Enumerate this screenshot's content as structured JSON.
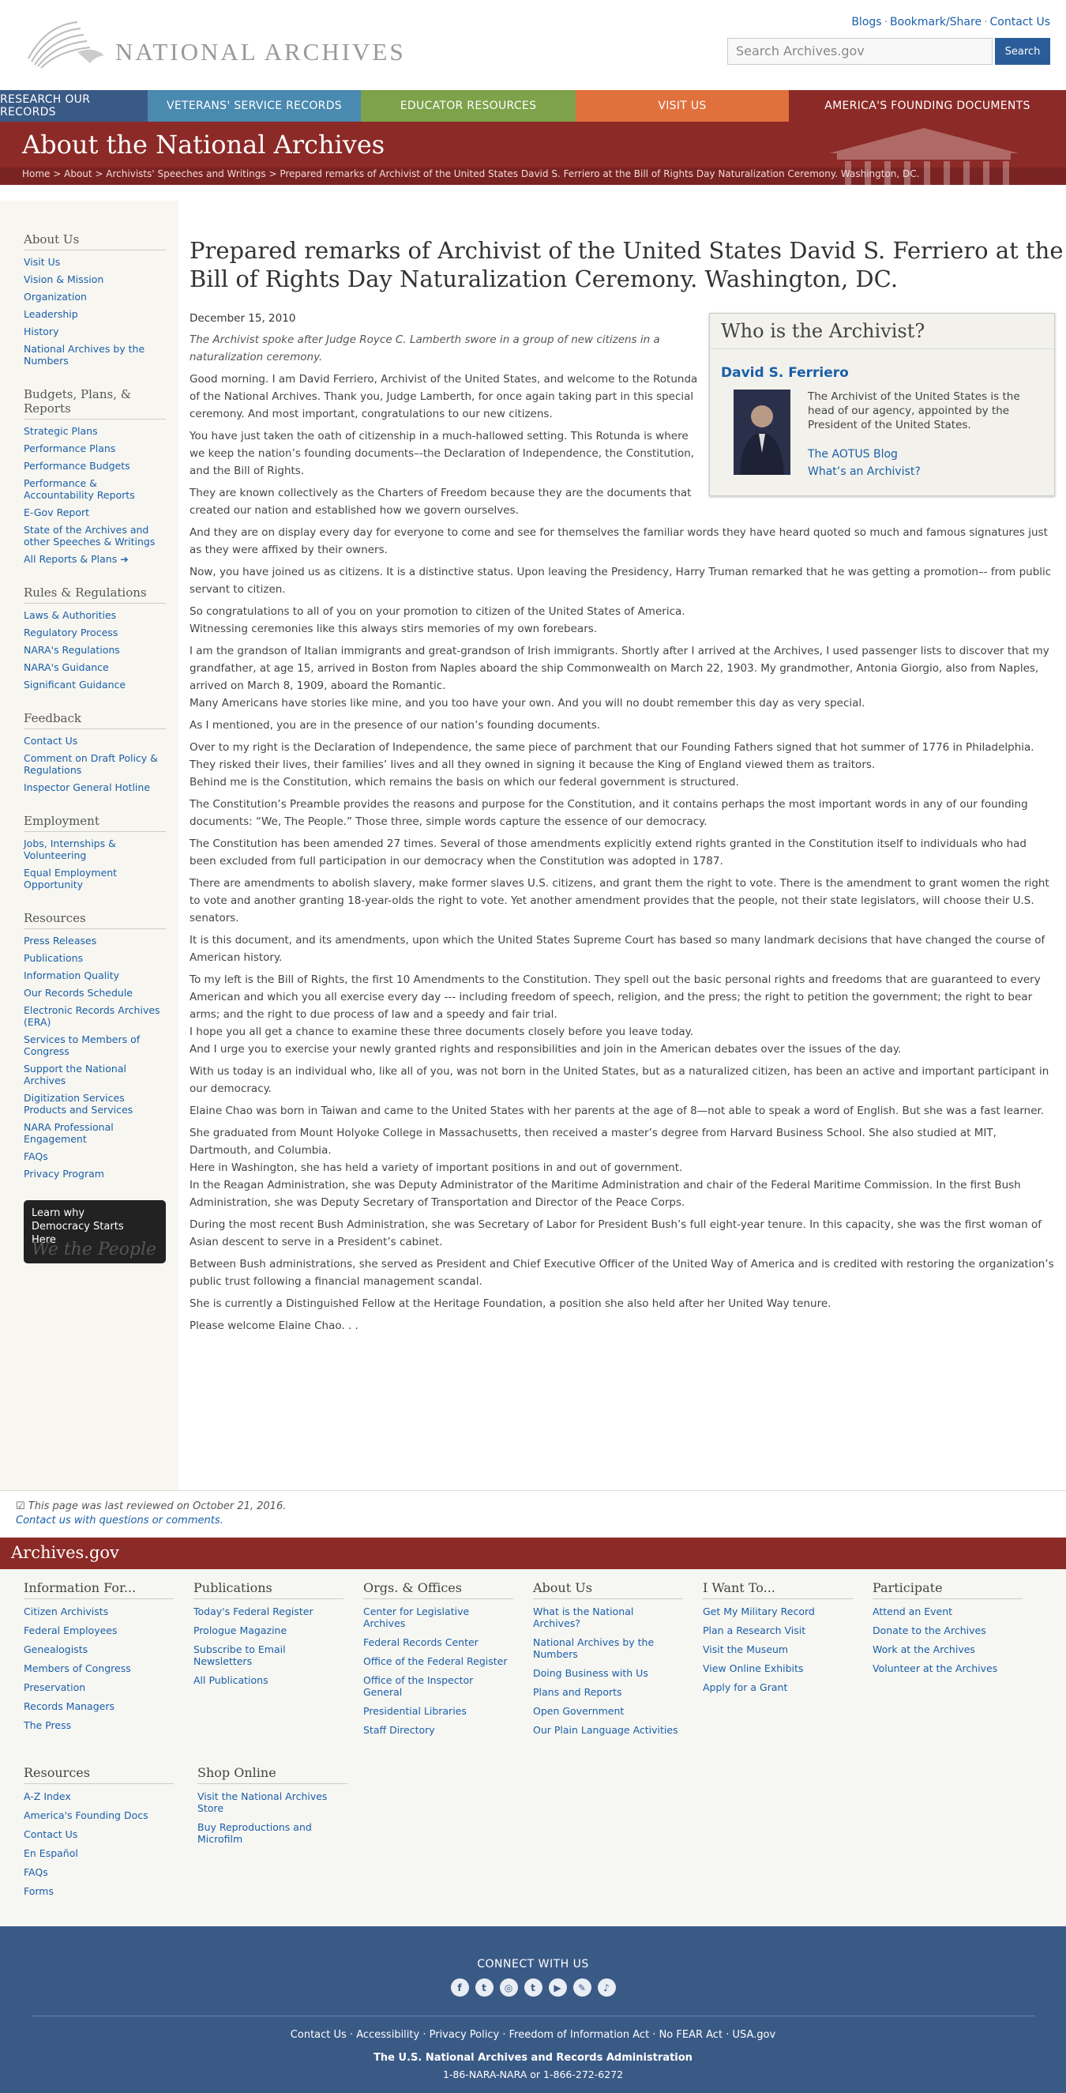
{
  "header": {
    "logo_text": "NATIONAL ARCHIVES",
    "links": [
      "Blogs",
      "Bookmark/Share",
      "Contact Us"
    ],
    "search_placeholder": "Search Archives.gov",
    "search_button": "Search"
  },
  "nav": [
    {
      "label": "RESEARCH OUR RECORDS",
      "color": "#3a5a86"
    },
    {
      "label": "VETERANS' SERVICE RECORDS",
      "color": "#4a8ab0"
    },
    {
      "label": "EDUCATOR RESOURCES",
      "color": "#7da24a"
    },
    {
      "label": "VISIT US",
      "color": "#e0703c"
    },
    {
      "label": "AMERICA'S FOUNDING DOCUMENTS",
      "color": "#8c2a27"
    }
  ],
  "banner": {
    "title": "About the National Archives",
    "crumbs": [
      "Home",
      "About",
      "Archivists' Speeches and Writings",
      "Prepared remarks of Archivist of the United States David S. Ferriero at the Bill of Rights Day Naturalization Ceremony. Washington, DC."
    ]
  },
  "sidebar": [
    {
      "heading": "About Us",
      "items": [
        "Visit Us",
        "Vision & Mission",
        "Organization",
        "Leadership",
        "History",
        "National Archives by the Numbers"
      ]
    },
    {
      "heading": "Budgets, Plans, & Reports",
      "items": [
        "Strategic Plans",
        "Performance Plans",
        "Performance Budgets",
        "Performance & Accountability Reports",
        "E-Gov Report",
        "State of the Archives and other Speeches & Writings",
        "All Reports & Plans"
      ]
    },
    {
      "heading": "Rules & Regulations",
      "items": [
        "Laws & Authorities",
        "Regulatory Process",
        "NARA's Regulations",
        "NARA's Guidance",
        "Significant Guidance"
      ]
    },
    {
      "heading": "Feedback",
      "items": [
        "Contact Us",
        "Comment on Draft Policy & Regulations",
        "Inspector General Hotline"
      ]
    },
    {
      "heading": "Employment",
      "items": [
        "Jobs, Internships & Volunteering",
        "Equal Employment Opportunity"
      ]
    },
    {
      "heading": "Resources",
      "items": [
        "Press Releases",
        "Publications",
        "Information Quality",
        "Our Records Schedule",
        "Electronic Records Archives (ERA)",
        "Services to Members of Congress",
        "Support the National Archives",
        "Digitization Services Products and Services",
        "NARA Professional Engagement",
        "FAQs",
        "Privacy Program"
      ]
    }
  ],
  "promo": {
    "text": "Learn why Democracy Starts Here",
    "script": "We the People"
  },
  "main": {
    "title": "Prepared remarks of Archivist of the United States David S. Ferriero at the Bill of Rights Day Naturalization Ceremony. Washington, DC.",
    "date": "December 15, 2010",
    "intro": "The Archivist spoke after Judge Royce C. Lamberth swore in a group of new citizens in a naturalization ceremony.",
    "paragraphs": [
      "Good morning. I am David Ferriero, Archivist of the United States, and welcome to the Rotunda of the National Archives. Thank you, Judge Lamberth, for once again taking part in this special ceremony. And most important, congratulations to our new citizens.",
      "You have just taken the oath of citizenship in a much-hallowed setting. This Rotunda is where we keep the nation’s founding documents–-the Declaration of Independence, the Constitution, and the Bill of Rights.",
      "They are known collectively as the Charters of Freedom because they are the documents that created our nation and established how we govern ourselves.",
      "And they are on display every day for everyone to come and see for themselves the familiar words they have heard quoted so much and famous signatures just as they were affixed by their owners.",
      "Now, you have joined us as citizens. It is a distinctive status. Upon leaving the Presidency, Harry Truman remarked that he was getting a promotion–- from public servant to citizen.",
      "So congratulations to all of you on your promotion to citizen of the United States of America.",
      "Witnessing ceremonies like this always stirs memories of my own forebears.",
      "I am the grandson of Italian immigrants and great-grandson of Irish immigrants. Shortly after I arrived at the Archives, I used passenger lists to discover that my grandfather, at age 15, arrived in Boston from Naples aboard the ship Commonwealth on March 22, 1903. My grandmother, Antonia Giorgio, also from Naples, arrived on March 8, 1909, aboard the Romantic.",
      "Many Americans have stories like mine, and you too have your own. And you will no doubt remember this day as very special.",
      "As I mentioned, you are in the presence of our nation’s founding documents.",
      "Over to my right is the Declaration of Independence, the same piece of parchment that our Founding Fathers signed that hot summer of 1776 in Philadelphia. They risked their lives, their families’ lives and all they owned in signing it because the King of England viewed them as traitors.",
      "Behind me is the Constitution, which remains the basis on which our federal government is structured.",
      "The Constitution’s Preamble provides the reasons and purpose for the Constitution, and it contains perhaps the most important words in any of our founding documents:  “We, The People.”   Those three, simple words capture the essence of our democracy.",
      "The Constitution has been amended 27 times. Several of those amendments explicitly extend rights granted in the Constitution itself to individuals who had been excluded from full participation in our democracy when the Constitution was adopted in 1787.",
      "There are amendments to abolish slavery, make former slaves U.S. citizens, and grant them the right to vote. There is the amendment to grant women the right to vote and another granting 18-year-olds the right to vote. Yet another amendment provides that the people, not their state legislators, will choose their U.S. senators.",
      "It is this document, and its amendments, upon which the United States Supreme Court has based so many landmark decisions that have changed the course of American history.",
      "To my left is the Bill of Rights, the first 10 Amendments to the Constitution.  They spell out the basic personal rights and freedoms that are guaranteed to every American and which you all exercise every day --- including freedom of speech, religion, and the press; the right to petition the government; the right to bear arms; and the right to due process of law and a speedy and fair trial.",
      "I hope you all get a chance to examine these three documents closely before you leave today.",
      "And I urge you to exercise your newly granted rights and responsibilities and join in the American debates over the issues of the day.",
      "With us today is an individual who, like all of you, was not born in the United States, but as a naturalized citizen, has been an active and important participant in our democracy.",
      "Elaine Chao was born in Taiwan and came to the United States with her parents at the age of 8—not able to speak a word of English. But she was a fast learner.",
      "She graduated from Mount Holyoke College in Massachusetts, then received a master’s degree from Harvard Business School. She also studied at MIT, Dartmouth, and Columbia.",
      "Here in Washington, she has held a variety of important positions in and out of government.",
      "In the Reagan Administration, she was Deputy Administrator of the Maritime Administration and chair of the Federal Maritime Commission. In the first Bush Administration, she was Deputy Secretary of Transportation and Director of the Peace Corps.",
      "During the most recent Bush Administration, she was Secretary of Labor for President Bush’s full eight-year tenure. In this capacity, she was the first woman of Asian descent to serve in a President’s cabinet.",
      "Between Bush administrations, she served as President and Chief Executive Officer of the United Way of America and is credited with restoring the organization’s public trust following a financial management scandal.",
      "She is currently a Distinguished Fellow at the Heritage Foundation, a position she also held after her United Way tenure.",
      "Please welcome Elaine Chao. . ."
    ]
  },
  "archivist_box": {
    "heading": "Who is the Archivist?",
    "name": "David S. Ferriero",
    "desc": "The Archivist of the United States is the head of our agency, appointed by the President of the United States.",
    "link1": "The AOTUS Blog",
    "link2": "What’s an Archivist?"
  },
  "reviewed": {
    "text": "This page was last reviewed on October 21, 2016.",
    "contact": "Contact us with questions or comments."
  },
  "agov": "Archives.gov",
  "footer": [
    {
      "heading": "Information For...",
      "items": [
        "Citizen Archivists",
        "Federal Employees",
        "Genealogists",
        "Members of Congress",
        "Preservation",
        "Records Managers",
        "The Press"
      ]
    },
    {
      "heading": "Publications",
      "items": [
        "Today's Federal Register",
        "Prologue Magazine",
        "Subscribe to Email Newsletters",
        "All Publications"
      ]
    },
    {
      "heading": "Orgs. & Offices",
      "items": [
        "Center for Legislative Archives",
        "Federal Records Center",
        "Office of the Federal Register",
        "Office of the Inspector General",
        "Presidential Libraries",
        "Staff Directory"
      ]
    },
    {
      "heading": "About Us",
      "items": [
        "What is the National Archives?",
        "National Archives by the Numbers",
        "Doing Business with Us",
        "Plans and Reports",
        "Open Government",
        "Our Plain Language Activities"
      ]
    },
    {
      "heading": "I Want To...",
      "items": [
        "Get My Military Record",
        "Plan a Research Visit",
        "Visit the Museum",
        "View Online Exhibits",
        "Apply for a Grant"
      ]
    },
    {
      "heading": "Participate",
      "items": [
        "Attend an Event",
        "Donate to the Archives",
        "Work at the Archives",
        "Volunteer at the Archives"
      ]
    }
  ],
  "footer2": [
    {
      "heading": "Resources",
      "items": [
        "A-Z Index",
        "America's Founding Docs",
        "Contact Us",
        "En Español",
        "FAQs",
        "Forms"
      ]
    },
    {
      "heading": "Shop Online",
      "items": [
        "Visit the National Archives Store",
        "Buy Reproductions and Microfilm"
      ]
    }
  ],
  "bottom": {
    "connect": "CONNECT WITH US",
    "icons": [
      "facebook-icon",
      "twitter-icon",
      "instagram-icon",
      "tumblr-icon",
      "youtube-icon",
      "blog-icon",
      "podcast-icon"
    ],
    "links": [
      "Contact Us",
      "Accessibility",
      "Privacy Policy",
      "Freedom of Information Act",
      "No FEAR Act",
      "USA.gov"
    ],
    "org": "The U.S. National Archives and Records Administration",
    "phone": "1-86-NARA-NARA or 1-866-272-6272"
  }
}
